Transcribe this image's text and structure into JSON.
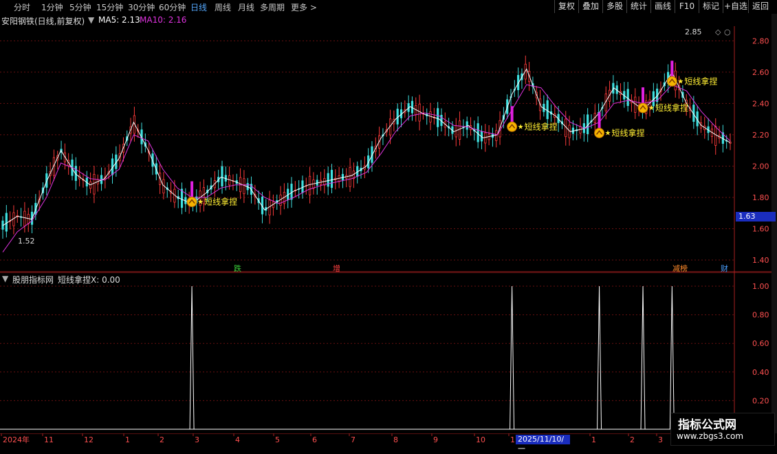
{
  "toolbar": {
    "tabs": [
      {
        "label": "分时"
      },
      {
        "label": "1分钟"
      },
      {
        "label": "5分钟"
      },
      {
        "label": "15分钟"
      },
      {
        "label": "30分钟"
      },
      {
        "label": "60分钟"
      },
      {
        "label": "日线"
      },
      {
        "label": "周线"
      },
      {
        "label": "月线"
      },
      {
        "label": "多周期"
      },
      {
        "label": "更多"
      }
    ],
    "more_icon": "chevron-right-icon",
    "right_buttons": [
      {
        "label": "复权"
      },
      {
        "label": "叠加"
      },
      {
        "label": "多股"
      },
      {
        "label": "统计"
      },
      {
        "label": "画线"
      },
      {
        "label": "F10"
      },
      {
        "label": "标记"
      },
      {
        "label": "+自选"
      },
      {
        "label": "返回"
      }
    ]
  },
  "main_chart": {
    "stock_name": "安阳钢铁",
    "period_desc": "(日线,前复权)",
    "ma5_label": "MA5: 2.13",
    "ma10_label": "MA10: 2.16",
    "high_marker": "2.85",
    "low_marker": "1.52",
    "current_price": "1.63",
    "y_ticks": [
      "2.80",
      "2.60",
      "2.40",
      "2.20",
      "2.00",
      "1.80",
      "1.60",
      "1.40"
    ],
    "signal_label": "短线拿捏",
    "event_badges": [
      {
        "label": "跌",
        "color": "#3ad13a"
      },
      {
        "label": "增",
        "color": "#ff4040"
      },
      {
        "label": "减榜",
        "color": "#ff8a2a"
      },
      {
        "label": "财",
        "color": "#4aa0ff"
      }
    ],
    "colors": {
      "up": "#ff3b3b",
      "down": "#3fe0e0",
      "ma5": "#ffffff",
      "ma10": "#e033e0",
      "signal": "#ffee33"
    }
  },
  "sub_chart": {
    "indicator_source": "股朋指标网",
    "indicator_value": "短线拿捏X: 0.00",
    "y_ticks": [
      "1.00",
      "0.80",
      "0.60",
      "0.40",
      "0.20"
    ]
  },
  "time_axis": {
    "labels": [
      "2024年",
      "11",
      "12",
      "1",
      "2",
      "3",
      "4",
      "5",
      "6",
      "7",
      "8",
      "9",
      "10",
      "11",
      "2025/11/10/一",
      "1",
      "2",
      "3"
    ]
  },
  "watermark": {
    "line1": "指标公式网",
    "line2": "www.zbgs3.com"
  },
  "chart_data": {
    "type": "line",
    "title": "安阳钢铁",
    "ylim": [
      1.4,
      2.85
    ],
    "series": [
      {
        "name": "MA5",
        "values": [
          1.62,
          1.68,
          1.66,
          1.9,
          2.1,
          1.95,
          1.88,
          1.92,
          2.05,
          2.28,
          2.1,
          1.88,
          1.8,
          1.76,
          1.83,
          1.93,
          1.9,
          1.86,
          1.72,
          1.78,
          1.84,
          1.88,
          1.9,
          1.92,
          1.94,
          2.0,
          2.18,
          2.3,
          2.38,
          2.33,
          2.3,
          2.22,
          2.26,
          2.18,
          2.2,
          2.46,
          2.62,
          2.38,
          2.32,
          2.22,
          2.24,
          2.34,
          2.5,
          2.43,
          2.36,
          2.45,
          2.6,
          2.4,
          2.26,
          2.2,
          2.15
        ]
      },
      {
        "name": "MA10",
        "values": [
          1.45,
          1.58,
          1.65,
          1.8,
          2.02,
          1.98,
          1.92,
          1.91,
          1.98,
          2.2,
          2.16,
          1.98,
          1.86,
          1.8,
          1.8,
          1.86,
          1.88,
          1.88,
          1.8,
          1.76,
          1.8,
          1.85,
          1.88,
          1.9,
          1.92,
          1.96,
          2.08,
          2.22,
          2.32,
          2.34,
          2.32,
          2.26,
          2.25,
          2.22,
          2.2,
          2.36,
          2.52,
          2.5,
          2.38,
          2.28,
          2.24,
          2.28,
          2.4,
          2.42,
          2.4,
          2.42,
          2.52,
          2.48,
          2.35,
          2.25,
          2.16
        ]
      },
      {
        "name": "短线拿捏X",
        "values": [
          0,
          0,
          0,
          0,
          0,
          0,
          0,
          0,
          0,
          0,
          0,
          0,
          0,
          1,
          0,
          0,
          0,
          0,
          0,
          0,
          0,
          0,
          0,
          0,
          0,
          0,
          0,
          0,
          0,
          0,
          0,
          0,
          0,
          0,
          0,
          1,
          0,
          0,
          0,
          0,
          0,
          1,
          0,
          0,
          1,
          0,
          1,
          0,
          0,
          0,
          0
        ]
      }
    ],
    "signals": [
      {
        "index": 13,
        "price": 1.78
      },
      {
        "index": 35,
        "price": 2.26
      },
      {
        "index": 41,
        "price": 2.22
      },
      {
        "index": 44,
        "price": 2.38
      },
      {
        "index": 46,
        "price": 2.55
      }
    ]
  }
}
